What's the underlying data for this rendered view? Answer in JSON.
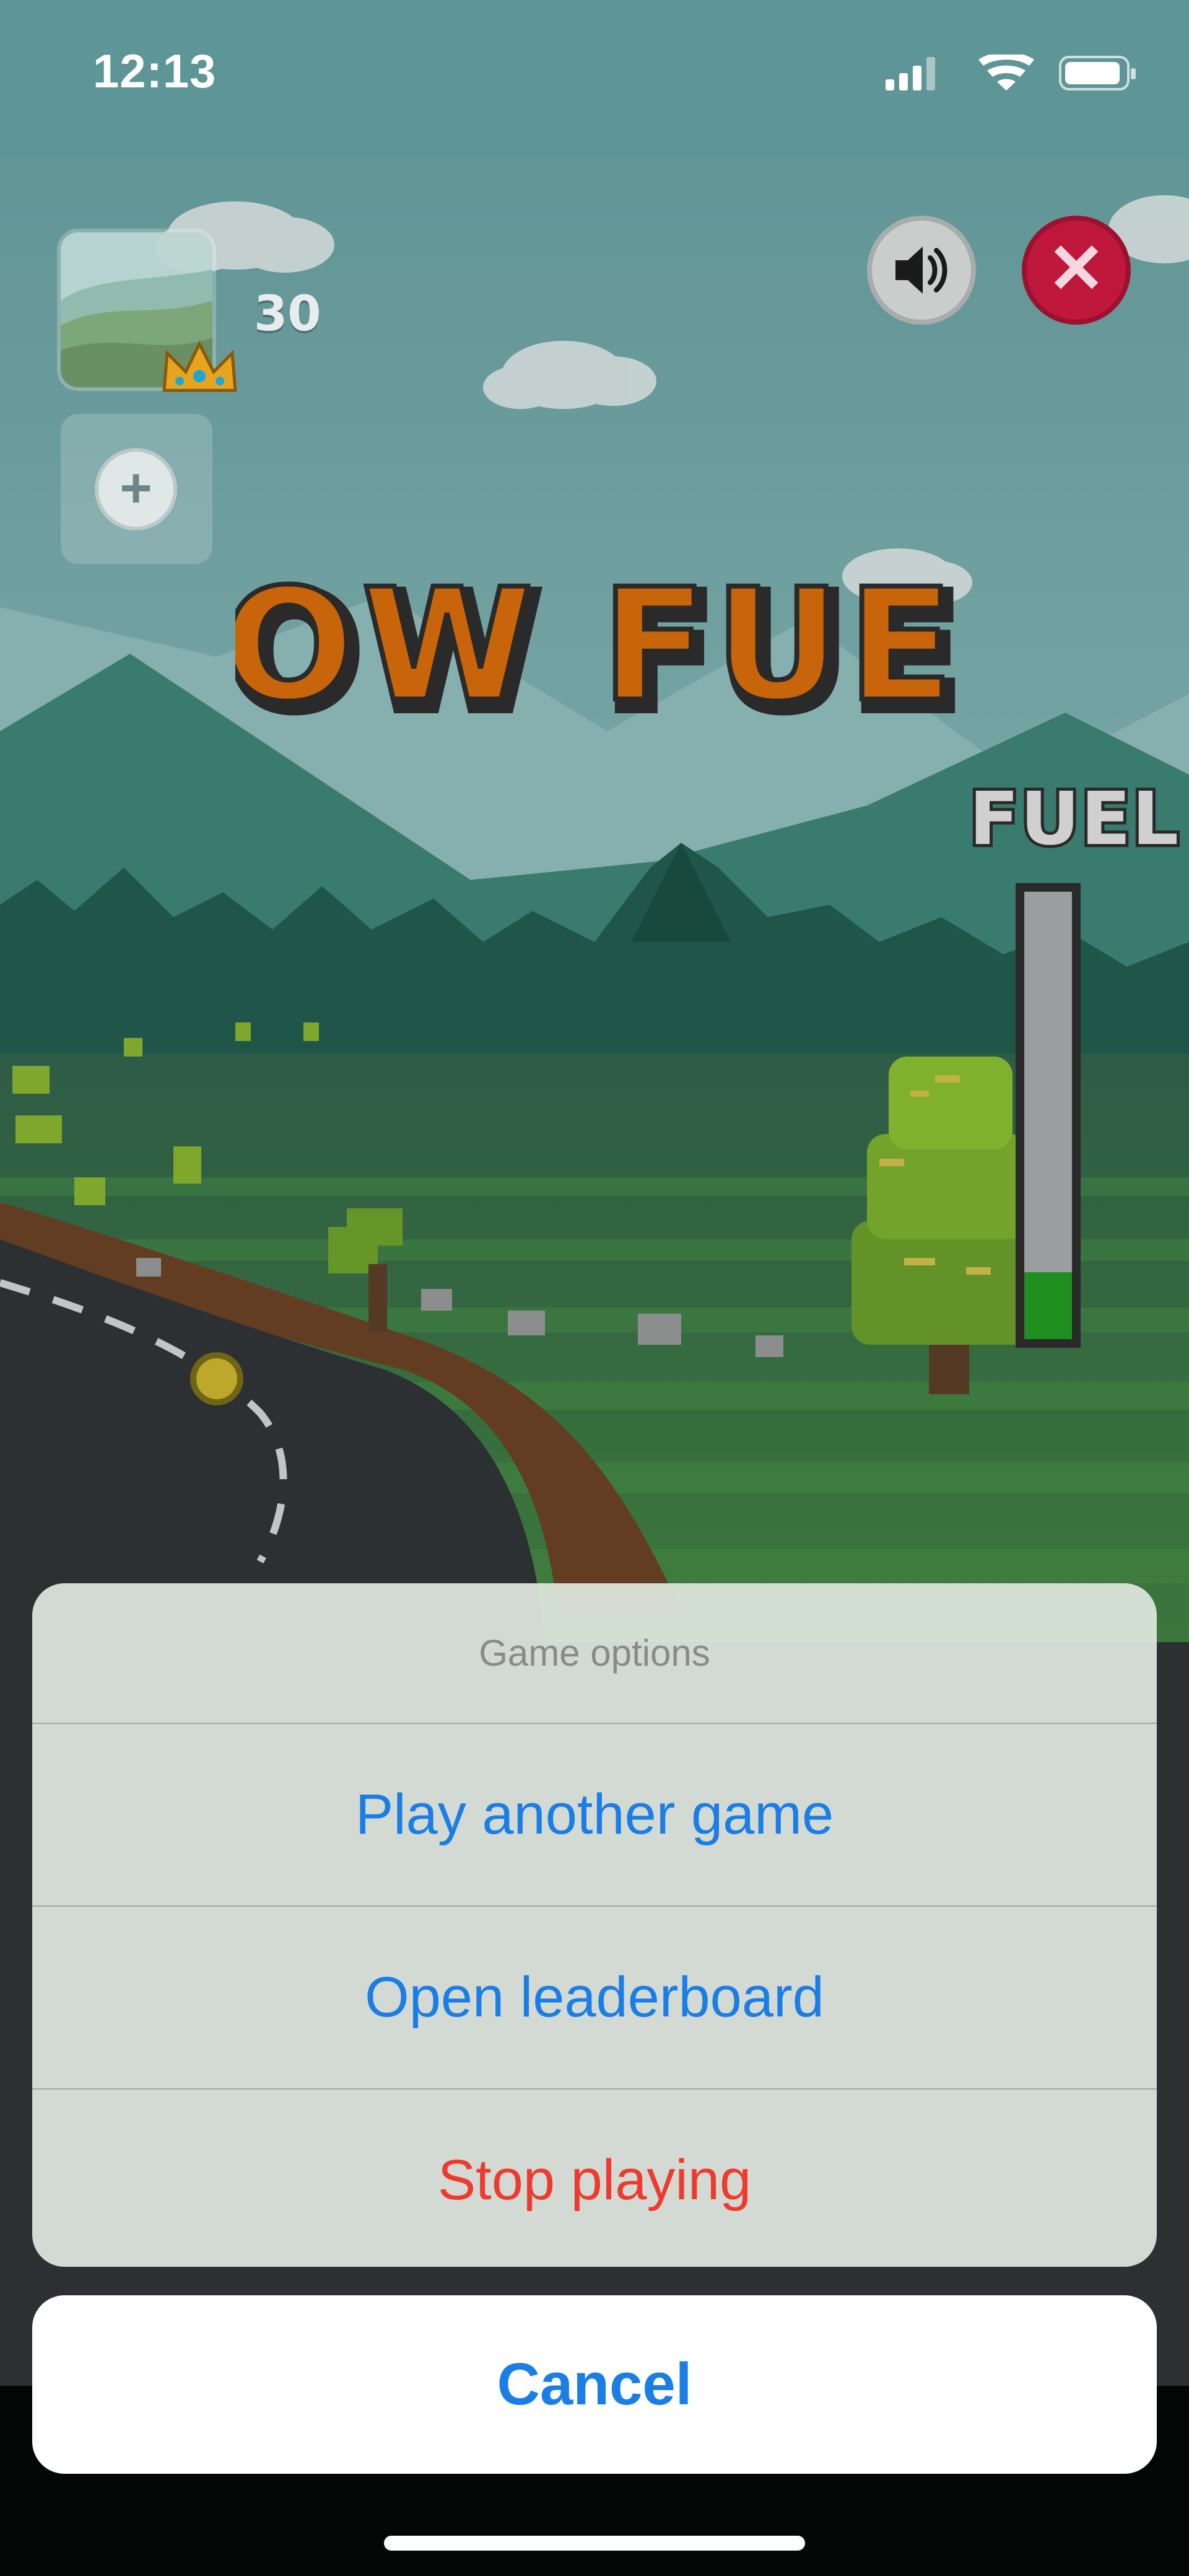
{
  "status_bar": {
    "time": "12:13",
    "icons": [
      "cellular-signal-icon",
      "wifi-icon",
      "battery-icon"
    ]
  },
  "game": {
    "score": "30",
    "banner_text": "LOW FUEL",
    "fuel_label": "FUEL",
    "fuel_level": 0.15,
    "colors": {
      "sky": "#7fb0b1",
      "banner_orange": "#c8640a",
      "close_red": "#c0173d",
      "fuel_green": "#1f8f1f",
      "grass": "#3f7d3a",
      "road": "#2d2f31"
    }
  },
  "action_sheet": {
    "title": "Game options",
    "options": [
      {
        "label": "Play another game",
        "style": "default"
      },
      {
        "label": "Open leaderboard",
        "style": "default"
      },
      {
        "label": "Stop playing",
        "style": "destructive"
      }
    ],
    "cancel_label": "Cancel",
    "colors": {
      "action_blue": "#1a7ee6",
      "destructive_red": "#ef3b2f"
    }
  }
}
